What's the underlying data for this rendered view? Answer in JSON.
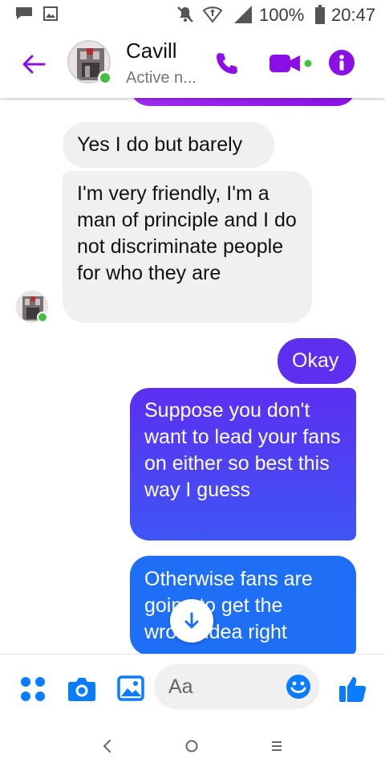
{
  "status_bar": {
    "icons": [
      "chat-notification-icon",
      "image-notification-icon",
      "mute-icon",
      "data-icon",
      "signal-icon",
      "battery-icon"
    ],
    "battery": "100%",
    "time": "20:47"
  },
  "header": {
    "contact_name": "Cavill",
    "contact_status": "Active n...",
    "icons": [
      "back-arrow-icon",
      "phone-icon",
      "video-camera-icon",
      "info-icon"
    ]
  },
  "messages": [
    {
      "direction": "incoming",
      "text": "Yes I do but barely"
    },
    {
      "direction": "incoming",
      "text": "I'm very friendly, I'm a man of principle and I do not discriminate people for who they are"
    },
    {
      "direction": "outgoing",
      "text": "Okay"
    },
    {
      "direction": "outgoing",
      "text": "Suppose you don't want to lead your fans on either so best this way I guess"
    },
    {
      "direction": "outgoing",
      "text": "Otherwise fans are going to get the wrong idea right"
    }
  ],
  "composer": {
    "placeholder": "Aa",
    "icons": [
      "apps-grid-icon",
      "camera-icon",
      "gallery-icon",
      "emoji-icon",
      "thumbs-up-icon"
    ]
  },
  "nav": {
    "icons": [
      "back-nav-icon",
      "home-icon",
      "recents-icon"
    ]
  },
  "colors": {
    "accent_purple": "#8a10e5",
    "incoming_bubble": "#f0f0f0",
    "outgoing_top": "#5f2ff0",
    "outgoing_bottom": "#1e6ef6",
    "online_green": "#44c144"
  }
}
